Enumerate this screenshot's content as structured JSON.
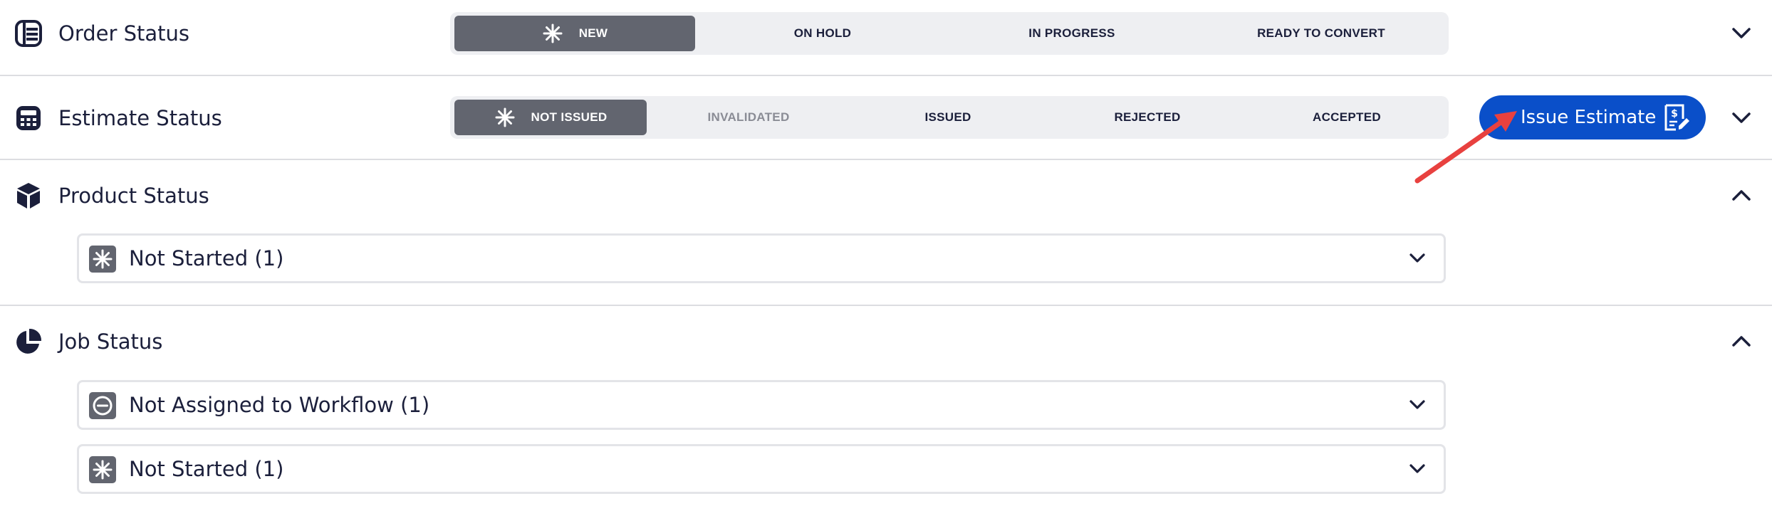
{
  "order_status": {
    "title": "Order Status",
    "icon": "order-list-icon",
    "options": [
      {
        "label": "NEW",
        "active": true
      },
      {
        "label": "ON HOLD",
        "active": false
      },
      {
        "label": "IN PROGRESS",
        "active": false
      },
      {
        "label": "READY TO CONVERT",
        "active": false
      }
    ]
  },
  "estimate_status": {
    "title": "Estimate Status",
    "icon": "calculator-icon",
    "options": [
      {
        "label": "NOT ISSUED",
        "active": true
      },
      {
        "label": "INVALIDATED",
        "active": false,
        "muted": true
      },
      {
        "label": "ISSUED",
        "active": false
      },
      {
        "label": "REJECTED",
        "active": false
      },
      {
        "label": "ACCEPTED",
        "active": false
      }
    ],
    "action_button": {
      "label": "Issue Estimate",
      "icon": "estimate-document-icon",
      "color": "#0a4fc9"
    }
  },
  "product_status": {
    "title": "Product Status",
    "icon": "box-icon",
    "rows": [
      {
        "label": "Not Started (1)",
        "icon": "asterisk-icon"
      }
    ]
  },
  "job_status": {
    "title": "Job Status",
    "icon": "pie-chart-icon",
    "rows": [
      {
        "label": "Not Assigned to Workflow (1)",
        "icon": "minus-circle-icon"
      },
      {
        "label": "Not Started (1)",
        "icon": "asterisk-icon"
      }
    ]
  },
  "colors": {
    "accent": "#0a4fc9",
    "active_segment": "#62656f",
    "segment_bg": "#eeeff2",
    "annotation_arrow": "#e8413f",
    "text": "#1b1f3b"
  }
}
